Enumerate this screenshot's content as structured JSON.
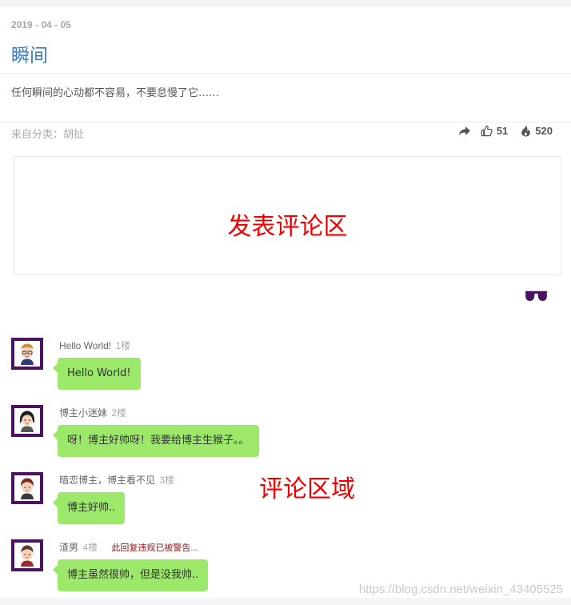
{
  "post": {
    "date": "2019 - 04 - 05",
    "title": "瞬间",
    "excerpt": "任何瞬间的心动都不容易，不要怠慢了它……",
    "category": "来自分类：胡扯",
    "likes": "51",
    "views": "520"
  },
  "editor": {
    "label": "发表评论区"
  },
  "comments": [
    {
      "name": "Hello World!",
      "floor": "1楼",
      "warning": "",
      "text": "Hello World!"
    },
    {
      "name": "博主小迷妹",
      "floor": "2楼",
      "warning": "",
      "text": "呀！博主好帅呀！我要给博主生猴子。。"
    },
    {
      "name": "暗恋博主，博主看不见",
      "floor": "3楼",
      "warning": "",
      "text": "博主好帅.."
    },
    {
      "name": "渣男",
      "floor": "4楼",
      "warning": "此回复违规已被警告...",
      "text": "博主虽然很帅，但是没我帅.."
    }
  ],
  "annotation": {
    "comments_area": "评论区域"
  },
  "watermark": "https://blog.csdn.net/weixin_43405525",
  "icons": [
    "share-icon",
    "thumbs-up-icon",
    "fire-icon",
    "sunglasses-icon",
    "avatar"
  ],
  "colors": {
    "title": "#3b7ab7",
    "bubble": "#9be86a",
    "annotation": "#f20000",
    "avatar_frame": "#4a1260"
  }
}
